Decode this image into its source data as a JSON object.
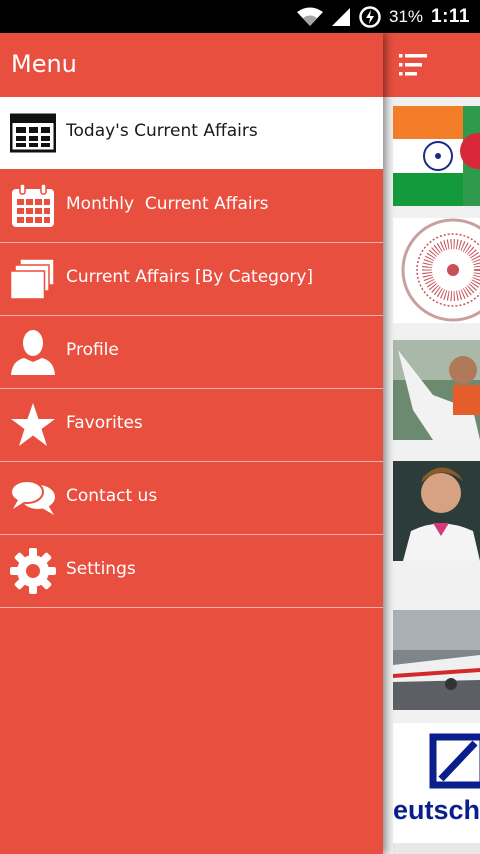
{
  "status_bar": {
    "battery": "31%",
    "time": "1:11"
  },
  "drawer": {
    "title": "Menu",
    "items": [
      {
        "label": "Today's Current Affairs",
        "icon": "newspaper-icon",
        "active": true
      },
      {
        "label": "Monthly  Current Affairs",
        "icon": "calendar-icon",
        "active": false
      },
      {
        "label": "Current Affairs [By Category]",
        "icon": "stacked-cards-icon",
        "active": false
      },
      {
        "label": "Profile",
        "icon": "person-icon",
        "active": false
      },
      {
        "label": "Favorites",
        "icon": "star-icon",
        "active": false
      },
      {
        "label": "Contact us",
        "icon": "chat-bubbles-icon",
        "active": false
      },
      {
        "label": "Settings",
        "icon": "gear-icon",
        "active": false
      }
    ]
  },
  "colors": {
    "accent": "#e94f3f",
    "status_bar": "#000000",
    "active_item_bg": "#ffffff"
  },
  "content": {
    "toolbar_icon": "list-icon",
    "thumbnails": [
      "india-flag-thumbnail",
      "emblem-seal-thumbnail",
      "cricket-player-thumbnail",
      "tennis-player-thumbnail",
      "airplane-thumbnail",
      "deutsche-bank-logo-thumbnail"
    ],
    "logo_text": "eutsch"
  }
}
